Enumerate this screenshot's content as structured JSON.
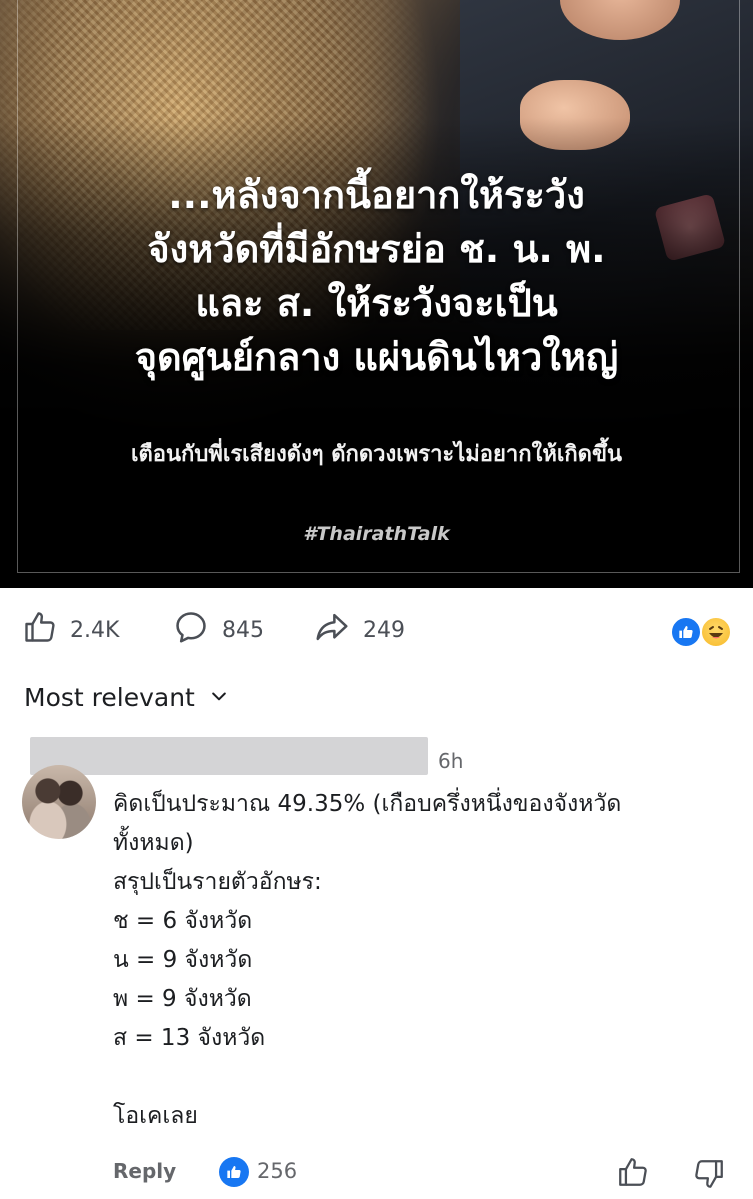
{
  "post_image": {
    "headline_lines": [
      "...หลังจากนี้อยากให้ระวัง",
      "จังหวัดที่มีอักษรย่อ ช. น. พ.",
      "และ ส. ให้ระวังจะเป็น",
      "จุดศูนย์กลาง แผ่นดินไหวใหญ่"
    ],
    "subline": "เตือนกับพี่เรเสียงดังๆ ดักดวงเพราะไม่อยากให้เกิดขึ้น",
    "hashtag": "#ThairathTalk"
  },
  "actions": {
    "likes": "2.4K",
    "comments": "845",
    "shares": "249",
    "reaction_icons": [
      "like-icon",
      "haha-icon"
    ]
  },
  "sort": {
    "label": "Most relevant"
  },
  "comment": {
    "timestamp": "6h",
    "body_lines": [
      "คิดเป็นประมาณ 49.35% (เกือบครึ่งหนึ่งของจังหวัด",
      "ทั้งหมด)",
      "สรุปเป็นรายตัวอักษร:",
      "ช = 6 จังหวัด",
      "น = 9 จังหวัด",
      "พ = 9 จังหวัด",
      "ส = 13 จังหวัด",
      "",
      "โอเคเลย"
    ],
    "reply_label": "Reply",
    "reaction_count": "256"
  },
  "colors": {
    "facebook_blue": "#1877f2",
    "muted_text": "#65676b",
    "redaction_gray": "#d4d4d6"
  }
}
